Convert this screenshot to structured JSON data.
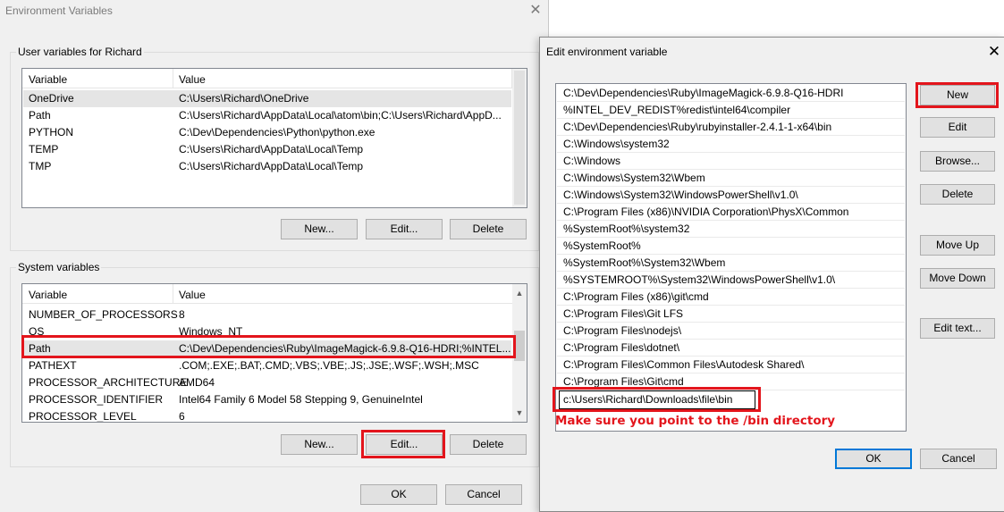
{
  "env_window": {
    "title": "Environment Variables",
    "close_glyph": "✕",
    "user_group": {
      "title": "User variables for Richard",
      "columns": [
        "Variable",
        "Value"
      ],
      "rows": [
        {
          "variable": "OneDrive",
          "value": "C:\\Users\\Richard\\OneDrive"
        },
        {
          "variable": "Path",
          "value": "C:\\Users\\Richard\\AppData\\Local\\atom\\bin;C:\\Users\\Richard\\AppD..."
        },
        {
          "variable": "PYTHON",
          "value": "C:\\Dev\\Dependencies\\Python\\python.exe"
        },
        {
          "variable": "TEMP",
          "value": "C:\\Users\\Richard\\AppData\\Local\\Temp"
        },
        {
          "variable": "TMP",
          "value": "C:\\Users\\Richard\\AppData\\Local\\Temp"
        }
      ],
      "buttons": {
        "new": "New...",
        "edit": "Edit...",
        "delete": "Delete"
      }
    },
    "system_group": {
      "title": "System variables",
      "columns": [
        "Variable",
        "Value"
      ],
      "rows": [
        {
          "variable": "NUMBER_OF_PROCESSORS",
          "value": "8"
        },
        {
          "variable": "OS",
          "value": "Windows_NT"
        },
        {
          "variable": "Path",
          "value": "C:\\Dev\\Dependencies\\Ruby\\ImageMagick-6.9.8-Q16-HDRI;%INTEL..."
        },
        {
          "variable": "PATHEXT",
          "value": ".COM;.EXE;.BAT;.CMD;.VBS;.VBE;.JS;.JSE;.WSF;.WSH;.MSC"
        },
        {
          "variable": "PROCESSOR_ARCHITECTURE",
          "value": "AMD64"
        },
        {
          "variable": "PROCESSOR_IDENTIFIER",
          "value": "Intel64 Family 6 Model 58 Stepping 9, GenuineIntel"
        },
        {
          "variable": "PROCESSOR_LEVEL",
          "value": "6"
        }
      ],
      "buttons": {
        "new": "New...",
        "edit": "Edit...",
        "delete": "Delete"
      }
    },
    "ok": "OK",
    "cancel": "Cancel"
  },
  "edit_dialog": {
    "title": "Edit environment variable",
    "close_glyph": "✕",
    "paths": [
      "C:\\Dev\\Dependencies\\Ruby\\ImageMagick-6.9.8-Q16-HDRI",
      "%INTEL_DEV_REDIST%redist\\intel64\\compiler",
      "C:\\Dev\\Dependencies\\Ruby\\rubyinstaller-2.4.1-1-x64\\bin",
      "C:\\Windows\\system32",
      "C:\\Windows",
      "C:\\Windows\\System32\\Wbem",
      "C:\\Windows\\System32\\WindowsPowerShell\\v1.0\\",
      "C:\\Program Files (x86)\\NVIDIA Corporation\\PhysX\\Common",
      "%SystemRoot%\\system32",
      "%SystemRoot%",
      "%SystemRoot%\\System32\\Wbem",
      "%SYSTEMROOT%\\System32\\WindowsPowerShell\\v1.0\\",
      "C:\\Program Files (x86)\\git\\cmd",
      "C:\\Program Files\\Git LFS",
      "C:\\Program Files\\nodejs\\",
      "C:\\Program Files\\dotnet\\",
      "C:\\Program Files\\Common Files\\Autodesk Shared\\",
      "C:\\Program Files\\Git\\cmd",
      "c:\\Users\\Richard\\Downloads\\file\\bin"
    ],
    "annotation": "Make sure you point to the /bin directory",
    "buttons": {
      "new": "New",
      "edit": "Edit",
      "browse": "Browse...",
      "delete": "Delete",
      "move_up": "Move Up",
      "move_down": "Move Down",
      "edit_text": "Edit text...",
      "ok": "OK",
      "cancel": "Cancel"
    }
  },
  "colors": {
    "highlight": "#e3151c",
    "accent": "#0078d7",
    "window_bg": "#f0f0f0"
  }
}
